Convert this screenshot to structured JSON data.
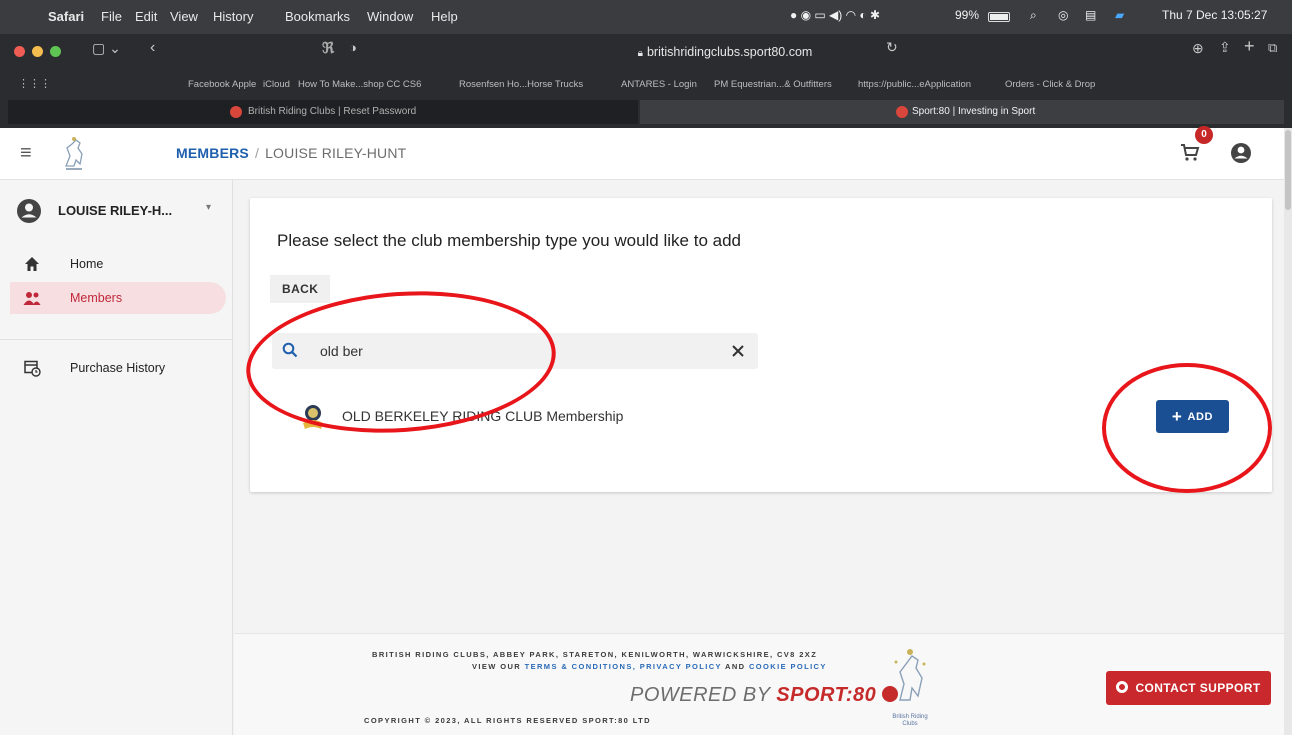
{
  "menubar": {
    "app": "Safari",
    "items": [
      "File",
      "Edit",
      "View",
      "History",
      "Bookmarks",
      "Window",
      "Help"
    ],
    "battery": "99%",
    "datetime": "Thu 7 Dec  13:05:27"
  },
  "browser": {
    "url": "britishridingclubs.sport80.com",
    "bookmarks": [
      "Facebook",
      "Apple",
      "iCloud",
      "How To Make...shop CC CS6",
      "Rosenfsen Ho...Horse Trucks",
      "ANTARES - Login",
      "PM Equestrian...& Outfitters",
      "https://public...eApplication",
      "Orders - Click & Drop"
    ],
    "tabs": [
      "British Riding Clubs | Reset Password",
      "Sport:80 | Investing in Sport"
    ]
  },
  "header": {
    "breadcrumb_link": "MEMBERS",
    "breadcrumb_sep": "/",
    "breadcrumb_current": "LOUISE RILEY-HUNT",
    "cart_count": "0"
  },
  "sidebar": {
    "user_name": "LOUISE RILEY-H...",
    "items": [
      {
        "label": "Home"
      },
      {
        "label": "Members"
      },
      {
        "label": "Purchase History"
      }
    ]
  },
  "main": {
    "title": "Please select the club membership type you would like to add",
    "back_label": "BACK",
    "search_value": "old ber",
    "result_label": "OLD BERKELEY RIDING CLUB Membership",
    "add_label": "ADD"
  },
  "footer": {
    "address": "BRITISH RIDING CLUBS, ABBEY PARK, STARETON, KENILWORTH, WARWICKSHIRE, CV8 2XZ",
    "view_our": "VIEW OUR",
    "terms": "TERMS & CONDITIONS,",
    "privacy": "PRIVACY POLICY",
    "and": "AND",
    "cookie": "COOKIE POLICY",
    "powered_prefix": "POWERED BY",
    "powered_brand": "SPORT:80",
    "copyright": "COPYRIGHT © 2023, ALL RIGHTS RESERVED SPORT:80 LTD",
    "contact_label": "CONTACT SUPPORT",
    "logo_text": "British Riding Clubs"
  },
  "colors": {
    "primary": "#1b4f93",
    "link": "#1e5fae",
    "danger": "#c9292c",
    "annotation": "#e8161b"
  }
}
